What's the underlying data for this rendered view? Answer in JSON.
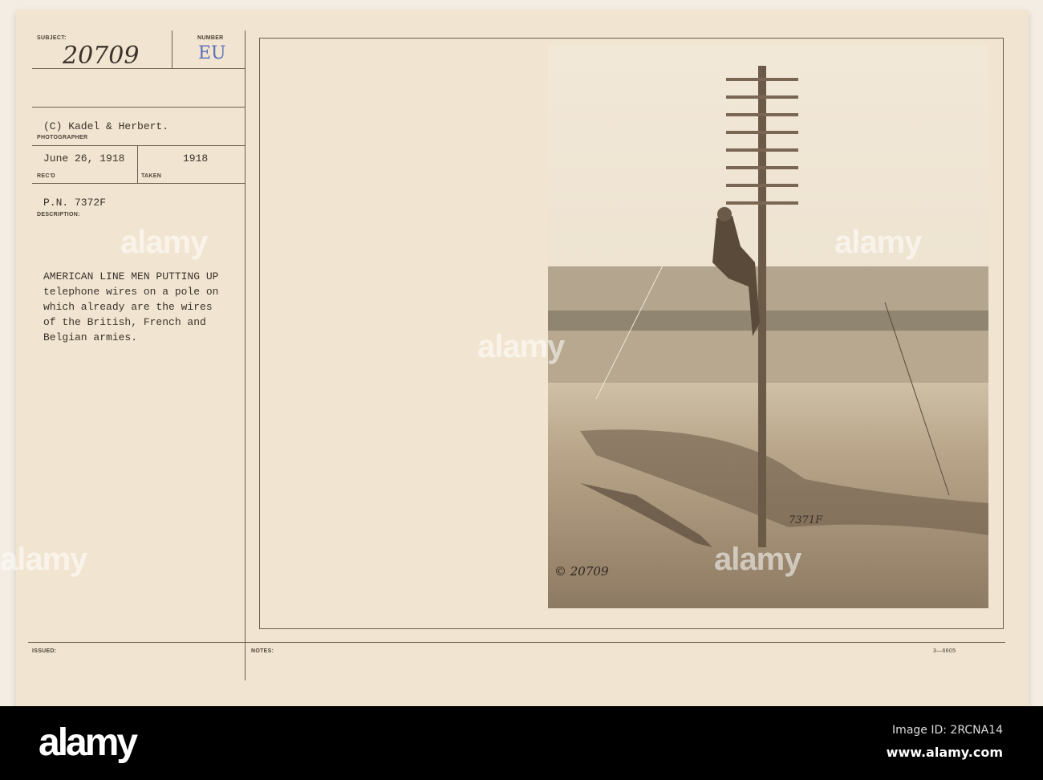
{
  "card": {
    "subject_label": "SUBJECT:",
    "subject_value": "20709",
    "number_label": "NUMBER",
    "number_value": "EU",
    "photographer_value": "(C) Kadel & Herbert.",
    "photographer_label": "PHOTOGRAPHER",
    "recd_value": "June 26, 1918",
    "recd_label": "REC'D",
    "taken_value": "1918",
    "taken_label": "TAKEN",
    "pn_value": "P.N. 7372F",
    "description_label": "DESCRIPTION:",
    "description_lines": [
      "AMERICAN LINE MEN PUTTING UP",
      "telephone wires on a pole on",
      "which already are the wires",
      "of the British, French and",
      "Belgian armies."
    ],
    "issued_label": "ISSUED:",
    "notes_label": "NOTES:",
    "form_code": "3—6605",
    "photo_mark_1": "7371F",
    "photo_mark_2": "© 20709"
  },
  "watermark": "alamy",
  "footer": {
    "logo": "alamy",
    "image_id": "Image ID: 2RCNA14",
    "url": "www.alamy.com"
  }
}
